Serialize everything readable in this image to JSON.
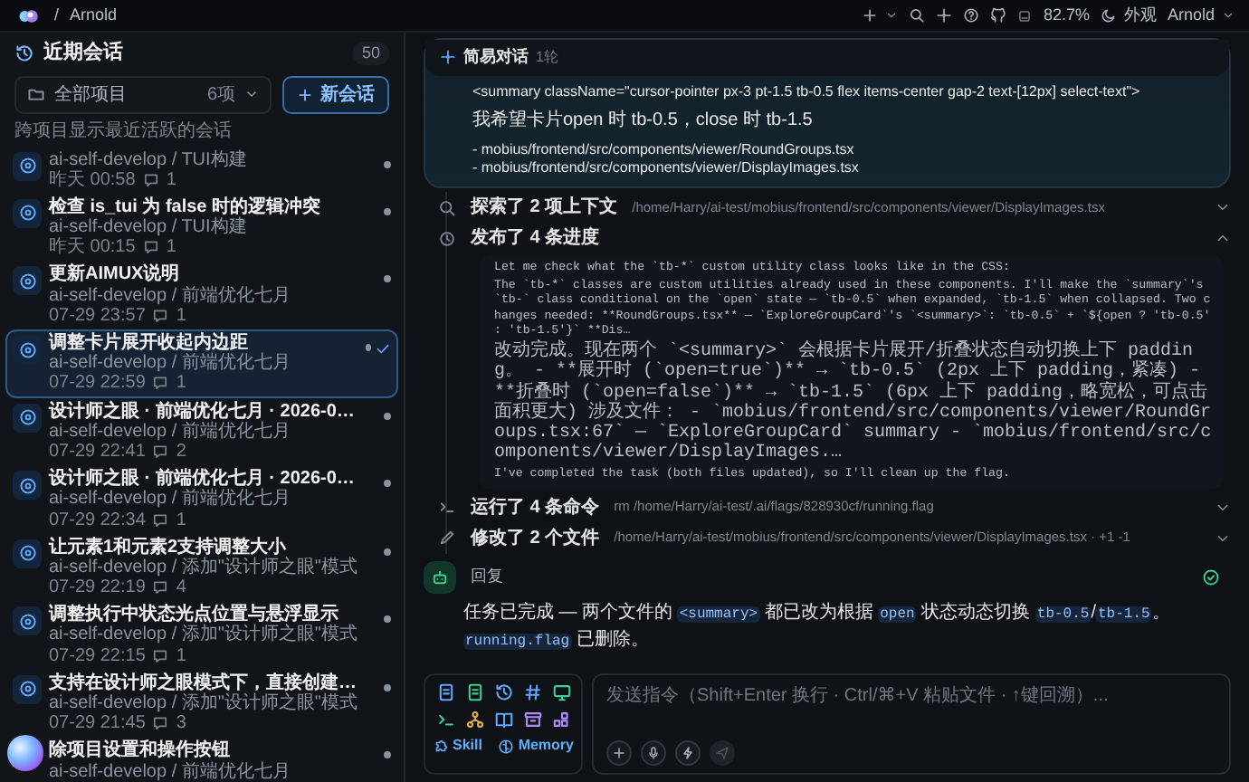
{
  "topbar": {
    "separator": "/",
    "project": "Arnold",
    "battery": "82.7%",
    "appearance": "外观",
    "user": "Arnold"
  },
  "sidebar": {
    "title": "近期会话",
    "count": "50",
    "filter": {
      "label": "全部项目",
      "count": "6项"
    },
    "new_button": "新会话",
    "hint": "跨项目显示最近活跃的会话",
    "items": [
      {
        "subtitle": "ai-self-develop / TUI构建",
        "time": "昨天 00:58",
        "comments": "1",
        "selected": false,
        "icon_visible": true
      },
      {
        "title": "检查 is_tui 为 false 时的逻辑冲突",
        "subtitle": "ai-self-develop / TUI构建",
        "time": "昨天 00:15",
        "comments": "1",
        "selected": false,
        "icon_visible": true
      },
      {
        "title": "更新AIMUX说明",
        "subtitle": "ai-self-develop / 前端优化七月",
        "time": "07-29 23:57",
        "comments": "1",
        "selected": false,
        "icon_visible": true
      },
      {
        "title": "调整卡片展开收起内边距",
        "subtitle": "ai-self-develop / 前端优化七月",
        "time": "07-29 22:59",
        "comments": "1",
        "selected": true,
        "icon_visible": true
      },
      {
        "title": "设计师之眼 · 前端优化七月 · 2026-0…",
        "subtitle": "ai-self-develop / 前端优化七月",
        "time": "07-29 22:41",
        "comments": "2",
        "selected": false,
        "icon_visible": true
      },
      {
        "title": "设计师之眼 · 前端优化七月 · 2026-0…",
        "subtitle": "ai-self-develop / 前端优化七月",
        "time": "07-29 22:34",
        "comments": "1",
        "selected": false,
        "icon_visible": true
      },
      {
        "title": "让元素1和元素2支持调整大小",
        "subtitle": "ai-self-develop / 添加\"设计师之眼\"模式",
        "time": "07-29 22:19",
        "comments": "4",
        "selected": false,
        "icon_visible": true
      },
      {
        "title": "调整执行中状态光点位置与悬浮显示",
        "subtitle": "ai-self-develop / 添加\"设计师之眼\"模式",
        "time": "07-29 22:15",
        "comments": "1",
        "selected": false,
        "icon_visible": true
      },
      {
        "title": "支持在设计师之眼模式下，直接创建…",
        "subtitle": "ai-self-develop / 添加\"设计师之眼\"模式",
        "time": "07-29 21:45",
        "comments": "3",
        "selected": false,
        "icon_visible": true
      },
      {
        "title": "除项目设置和操作按钮",
        "subtitle": "ai-self-develop / 前端优化七月",
        "selected": false,
        "icon_visible": false
      }
    ]
  },
  "card": {
    "title": "简易对话",
    "rounds": "1轮",
    "paragraphs": [
      {
        "lines": [
          "<summary className=\"cursor-pointer px-3 pt-1.5 tb-0.5 flex items-center gap-2 text-[12px] select-text\">"
        ]
      },
      {
        "lines": [
          "我希望卡片open 时 tb-0.5，close 时 tb-1.5"
        ]
      },
      {
        "lines": [
          "- mobius/frontend/src/components/viewer/RoundGroups.tsx",
          "- mobius/frontend/src/components/viewer/DisplayImages.tsx"
        ]
      }
    ]
  },
  "timeline": [
    {
      "kind": "explore",
      "title": "探索了 2 项上下文",
      "detail": "/home/Harry/ai-test/mobius/frontend/src/components/viewer/DisplayImages.tsx",
      "expanded": false
    },
    {
      "kind": "progress",
      "title": "发布了 4 条进度",
      "expanded": true,
      "entries": [
        "Let me check what the `tb-*` custom utility class looks like in the CSS:",
        "The `tb-*` classes are custom utilities already used in these components. I'll make the `summary`'s `tb-` class conditional on the `open` state — `tb-0.5` when expanded, `tb-1.5` when collapsed. Two changes needed: **RoundGroups.tsx** — `ExploreGroupCard`'s `<summary>`: `tb-0.5` + `${open ? 'tb-0.5' : 'tb-1.5'}` **Dis…",
        "改动完成。现在两个 `<summary>` 会根据卡片展开/折叠状态自动切换上下 padding。 - **展开时 (`open=true`)** → `tb-0.5` (2px 上下 padding，紧凑) - **折叠时 (`open=false`)** → `tb-1.5` (6px 上下 padding，略宽松，可点击面积更大) 涉及文件： - `mobius/frontend/src/components/viewer/RoundGroups.tsx:67` — `ExploreGroupCard` summary - `mobius/frontend/src/components/viewer/DisplayImages.…",
        "I've completed the task (both files updated), so I'll clean up the flag."
      ]
    },
    {
      "kind": "command",
      "title": "运行了 4 条命令",
      "detail": "rm /home/Harry/ai-test/.ai/flags/828930cf/running.flag",
      "expanded": false
    },
    {
      "kind": "edit",
      "title": "修改了 2 个文件",
      "detail": "/home/Harry/ai-test/mobius/frontend/src/components/viewer/DisplayImages.tsx · +1 -1",
      "expanded": false
    }
  ],
  "reply": {
    "label": "回复",
    "done": true,
    "segments": [
      {
        "text": "任务已完成 — 两个文件的 ",
        "code": false
      },
      {
        "text": "<summary>",
        "code": true
      },
      {
        "text": " 都已改为根据 ",
        "code": false
      },
      {
        "text": "open",
        "code": true
      },
      {
        "text": " 状态动态切换 ",
        "code": false
      },
      {
        "text": "tb-0.5",
        "code": true
      },
      {
        "text": "/",
        "code": false
      },
      {
        "text": "tb-1.5",
        "code": true
      },
      {
        "text": "。",
        "code": false
      },
      {
        "text": "running.flag",
        "code": true
      },
      {
        "text": " 已删除。",
        "code": false
      }
    ]
  },
  "composer": {
    "skill_button": "Skill",
    "memory_button": "Memory",
    "placeholder": "发送指令（Shift+Enter 换行 · Ctrl/⌘+V 粘贴文件 · ↑键回溯）...",
    "send_disabled": true
  }
}
